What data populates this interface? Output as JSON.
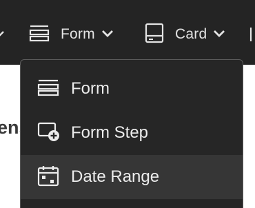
{
  "toolbar": {
    "form_label": "Form",
    "card_label": "Card"
  },
  "page": {
    "partial_heading": "ens"
  },
  "menu": {
    "items": [
      {
        "label": "Form",
        "icon": "form-icon",
        "highlighted": false
      },
      {
        "label": "Form Step",
        "icon": "form-step-add-icon",
        "highlighted": false
      },
      {
        "label": "Date Range",
        "icon": "calendar-icon",
        "highlighted": true
      }
    ]
  },
  "colors": {
    "toolbar_bg": "#242424",
    "menu_bg": "#262626",
    "menu_highlight": "#363636",
    "menu_border": "#5c5c5c",
    "text": "#ececec"
  }
}
